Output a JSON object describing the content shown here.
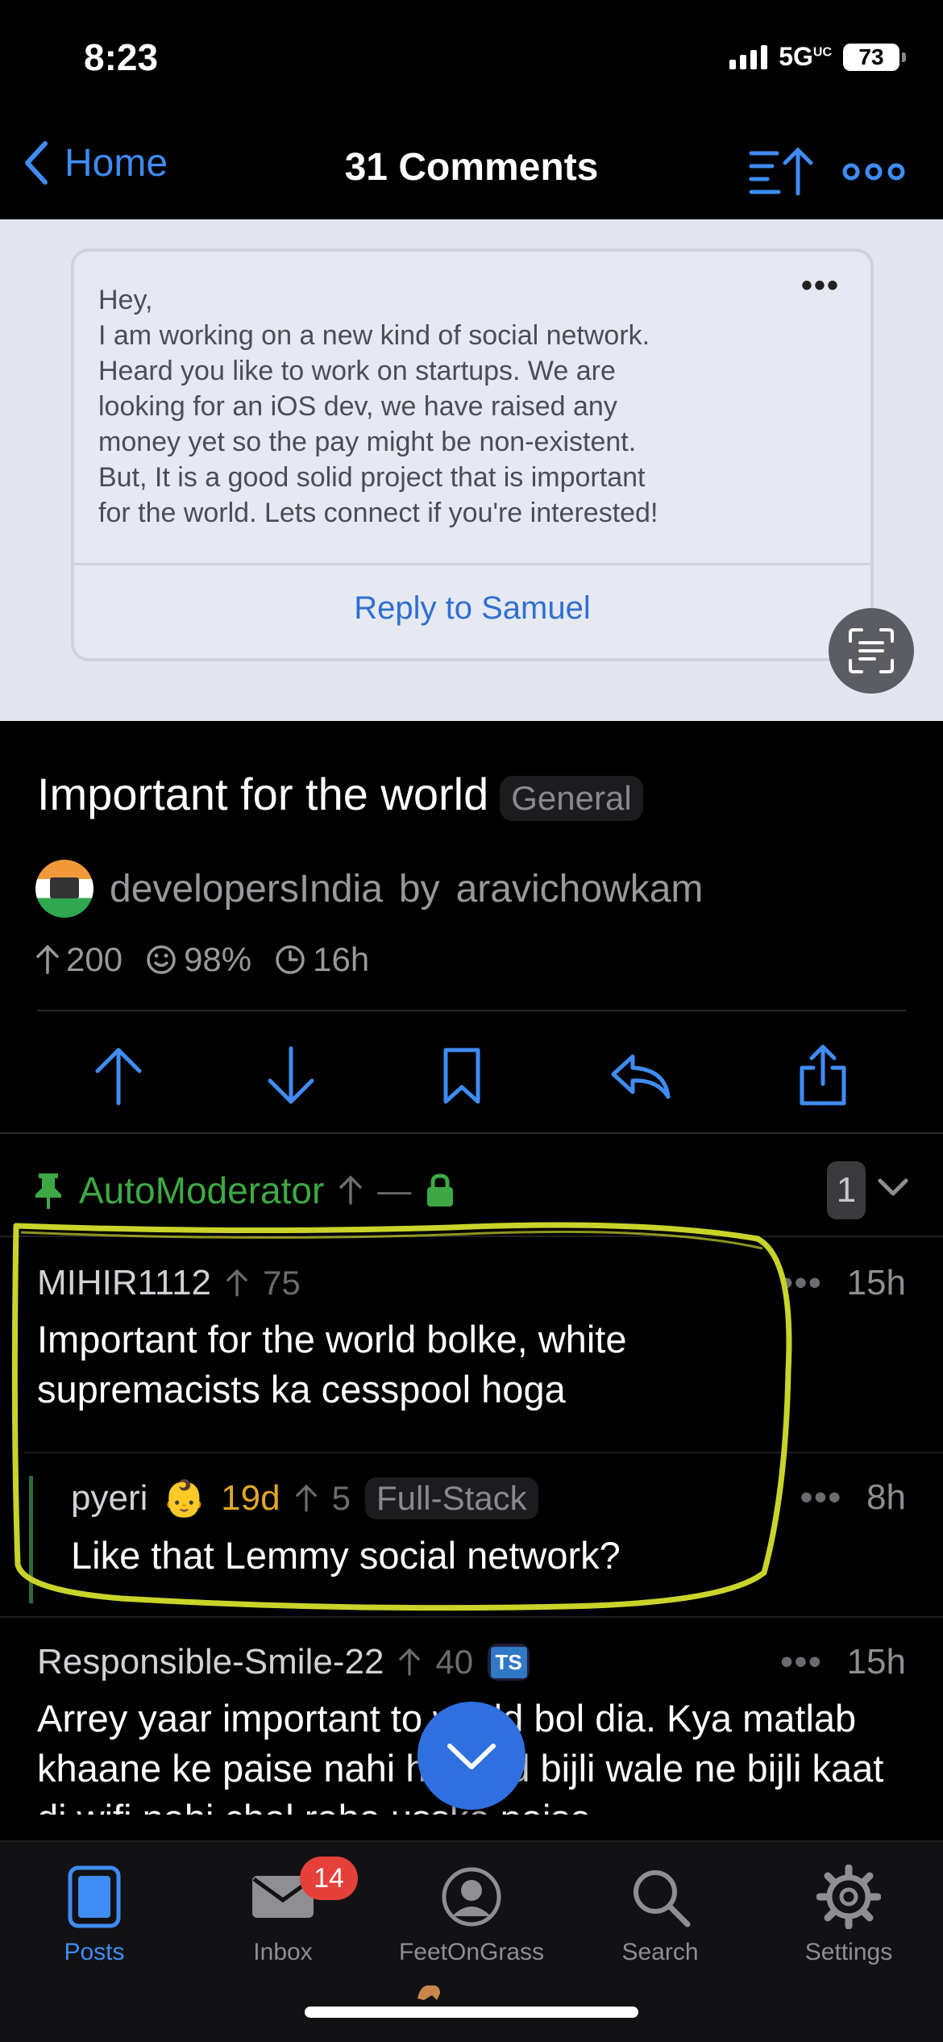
{
  "status_bar": {
    "time": "8:23",
    "network": "5G",
    "network_sup": "UC",
    "battery": "73"
  },
  "nav": {
    "back_label": "Home",
    "title": "31 Comments"
  },
  "image": {
    "message": "Hey,\nI am working on a new kind of social network.\nHeard you like to work on startups. We are\nlooking for an iOS dev, we have raised any\nmoney yet so the pay might be non-existent.\nBut, It is a good solid project that is important\nfor the world. Lets connect if you're interested!",
    "reply_label": "Reply to Samuel",
    "more_label": "•••"
  },
  "post": {
    "title": "Important for the world",
    "flair": "General",
    "community": "developersIndia",
    "by": "by",
    "author": "aravichowkam",
    "upvotes": "200",
    "ratio": "98%",
    "age": "16h"
  },
  "automod": {
    "name": "AutoModerator",
    "votes": "—",
    "count": "1"
  },
  "comments": [
    {
      "author": "MIHIR1112",
      "score": "75",
      "age": "15h",
      "more": "•••",
      "body": "Important for the world bolke, white supremacists ka cesspool hoga"
    },
    {
      "author": "pyeri",
      "emoji": "👶",
      "account_age": "19d",
      "score": "5",
      "flair": "Full-Stack",
      "age": "8h",
      "more": "•••",
      "body": "Like that Lemmy social network?"
    },
    {
      "author": "Responsible-Smile-22",
      "score": "40",
      "badge": "TS",
      "age": "15h",
      "more": "•••",
      "body": "Arrey yaar important to world bol dia. Kya matlab khaane ke paise nahi hai and bijli wale ne bijli kaat di wifi nahi chal raha usske paise"
    }
  ],
  "tabs": [
    {
      "label": "Posts",
      "icon": "posts-icon"
    },
    {
      "label": "Inbox",
      "icon": "inbox-icon",
      "badge": "14"
    },
    {
      "label": "FeetOnGrass",
      "icon": "profile-icon"
    },
    {
      "label": "Search",
      "icon": "search-icon"
    },
    {
      "label": "Settings",
      "icon": "gear-icon"
    }
  ],
  "colors": {
    "accent": "#3f8cf4",
    "moderator_green": "#3ea944",
    "highlight": "#c9d42a",
    "badge_red": "#e5403a"
  }
}
